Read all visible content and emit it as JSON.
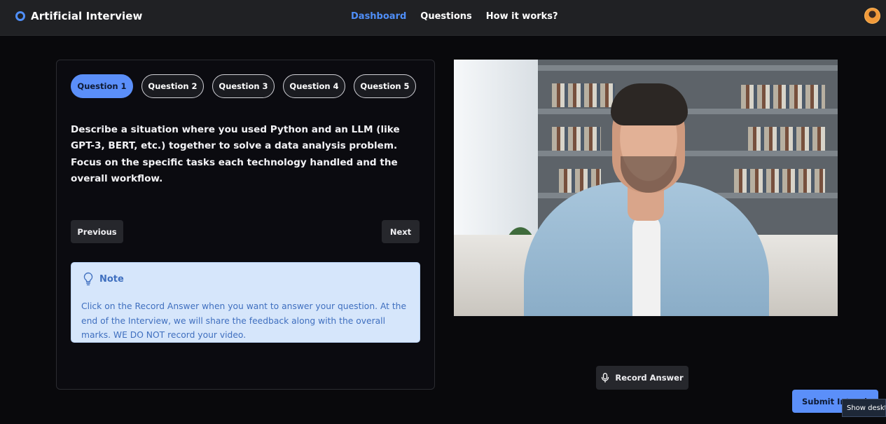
{
  "app": {
    "title": "Artificial Interview"
  },
  "nav": {
    "items": [
      "Dashboard",
      "Questions",
      "How it works?"
    ],
    "active": "Dashboard"
  },
  "tabs": [
    "Question 1",
    "Question 2",
    "Question 3",
    "Question 4",
    "Question 5"
  ],
  "active_tab": "Question 1",
  "question_text": "Describe a situation where you used Python and an LLM (like GPT-3, BERT, etc.) together to solve a data analysis problem. Focus on the specific tasks each technology handled and the overall workflow.",
  "buttons": {
    "previous": "Previous",
    "next": "Next",
    "record": "Record Answer",
    "submit": "Submit Interview"
  },
  "note": {
    "title": "Note",
    "text": "Click on the Record Answer when you want to answer your question. At the end of the Interview, we will share the feedback along with the overall marks. WE DO NOT record your video."
  },
  "tooltip": {
    "show_desktop": "Show desktop"
  },
  "icons": {
    "brand": "ring-icon",
    "avatar": "user-avatar",
    "note": "lightbulb-icon",
    "record": "microphone-icon"
  },
  "colors": {
    "accent": "#5b8ff9",
    "background": "#09090c",
    "header": "#202124",
    "note_bg": "#d6e6fb",
    "note_text": "#3f6fbf"
  }
}
